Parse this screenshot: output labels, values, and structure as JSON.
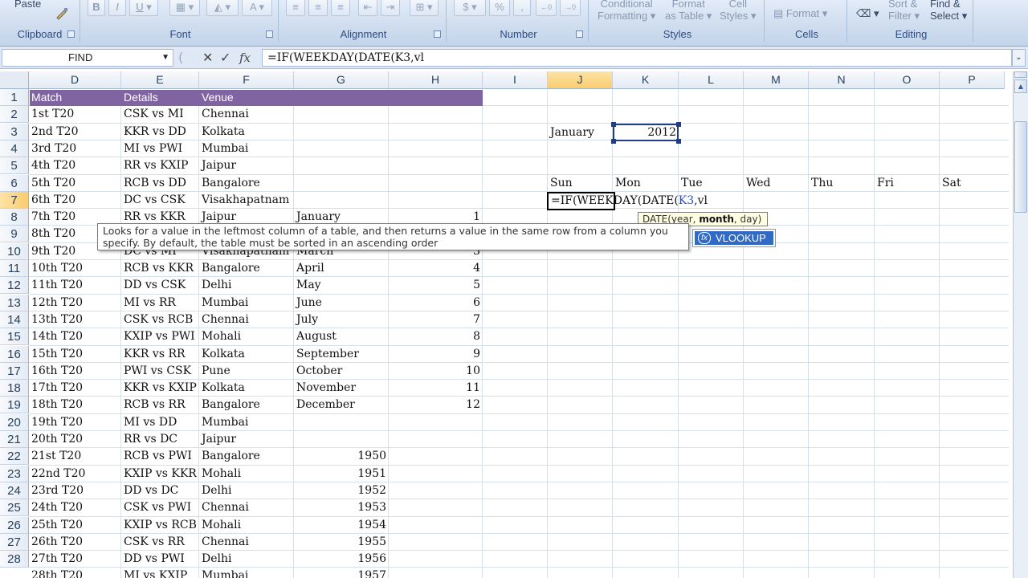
{
  "ribbon": {
    "clipboard": {
      "label": "Clipboard",
      "paste": "Paste"
    },
    "font": {
      "label": "Font",
      "bold": "B",
      "italic": "I",
      "underline": "U"
    },
    "alignment": {
      "label": "Alignment"
    },
    "number": {
      "label": "Number",
      "currency": "$",
      "percent": "%",
      "comma": ","
    },
    "styles": {
      "label": "Styles",
      "conditional_formatting": "Conditional Formatting",
      "format_as_table": "Format as Table",
      "cell_styles": "Cell Styles",
      "conditional_l1": "Conditional",
      "conditional_l2": "Formatting",
      "format_l1": "Format",
      "format_l2": "as Table",
      "cell_l1": "Cell",
      "cell_l2": "Styles"
    },
    "cells": {
      "label": "Cells",
      "format": "Format"
    },
    "editing": {
      "label": "Editing",
      "sort_l1": "Sort &",
      "sort_l2": "Filter",
      "find_l1": "Find &",
      "find_l2": "Select"
    }
  },
  "formula_bar": {
    "name_box": "FIND",
    "formula": "=IF(WEEKDAY(DATE(K3,vl"
  },
  "columns": [
    "D",
    "E",
    "F",
    "G",
    "H",
    "I",
    "J",
    "K",
    "L",
    "M",
    "N",
    "O",
    "P"
  ],
  "selected_column": "J",
  "rows": [
    "1",
    "2",
    "3",
    "4",
    "5",
    "6",
    "7",
    "8",
    "9",
    "10",
    "11",
    "12",
    "13",
    "14",
    "15",
    "16",
    "17",
    "18",
    "19",
    "20",
    "21",
    "22",
    "23",
    "24",
    "25",
    "26",
    "27",
    "28"
  ],
  "selected_row": "7",
  "table_header": {
    "match": "Match",
    "details": "Details",
    "venue": "Venue"
  },
  "matches": [
    {
      "match": "1st T20",
      "details": "CSK vs MI",
      "venue": "Chennai"
    },
    {
      "match": "2nd T20",
      "details": "KKR vs DD",
      "venue": "Kolkata"
    },
    {
      "match": "3rd T20",
      "details": "MI vs PWI",
      "venue": "Mumbai"
    },
    {
      "match": "4th T20",
      "details": "RR vs KXIP",
      "venue": "Jaipur"
    },
    {
      "match": "5th T20",
      "details": "RCB vs DD",
      "venue": "Bangalore"
    },
    {
      "match": "6th T20",
      "details": "DC vs CSK",
      "venue": "Visakhapatnam"
    },
    {
      "match": "7th T20",
      "details": "RR vs KKR",
      "venue": "Jaipur"
    },
    {
      "match": "8th T20",
      "details": "",
      "venue": ""
    },
    {
      "match": "9th T20",
      "details": "DC vs MI",
      "venue": "Visakhapatnam"
    },
    {
      "match": "10th T20",
      "details": "RCB vs KKR",
      "venue": "Bangalore"
    },
    {
      "match": "11th T20",
      "details": "DD vs CSK",
      "venue": "Delhi"
    },
    {
      "match": "12th T20",
      "details": "MI vs RR",
      "venue": "Mumbai"
    },
    {
      "match": "13th T20",
      "details": "CSK vs RCB",
      "venue": "Chennai"
    },
    {
      "match": "14th T20",
      "details": "KXIP vs PWI",
      "venue": "Mohali"
    },
    {
      "match": "15th T20",
      "details": "KKR vs RR",
      "venue": "Kolkata"
    },
    {
      "match": "16th T20",
      "details": "PWI vs CSK",
      "venue": "Pune"
    },
    {
      "match": "17th T20",
      "details": "KKR vs KXIP",
      "venue": "Kolkata"
    },
    {
      "match": "18th T20",
      "details": "RCB vs RR",
      "venue": "Bangalore"
    },
    {
      "match": "19th T20",
      "details": "MI vs DD",
      "venue": "Mumbai"
    },
    {
      "match": "20th T20",
      "details": "RR vs DC",
      "venue": "Jaipur"
    },
    {
      "match": "21st T20",
      "details": "RCB vs PWI",
      "venue": "Bangalore"
    },
    {
      "match": "22nd T20",
      "details": "KXIP vs KKR",
      "venue": "Mohali"
    },
    {
      "match": "23rd T20",
      "details": "DD vs DC",
      "venue": "Delhi"
    },
    {
      "match": "24th T20",
      "details": "CSK vs PWI",
      "venue": "Chennai"
    },
    {
      "match": "25th T20",
      "details": "KXIP vs RCB",
      "venue": "Mohali"
    },
    {
      "match": "26th T20",
      "details": "CSK vs RR",
      "venue": "Chennai"
    },
    {
      "match": "27th T20",
      "details": "DD vs PWI",
      "venue": "Delhi"
    },
    {
      "match": "28th T20",
      "details": "MI vs KXIP",
      "venue": "Mumbai"
    }
  ],
  "month_list": [
    {
      "name": "January",
      "num": "1"
    },
    {
      "name": "",
      "num": ""
    },
    {
      "name": "March",
      "num": "3"
    },
    {
      "name": "April",
      "num": "4"
    },
    {
      "name": "May",
      "num": "5"
    },
    {
      "name": "June",
      "num": "6"
    },
    {
      "name": "July",
      "num": "7"
    },
    {
      "name": "August",
      "num": "8"
    },
    {
      "name": "September",
      "num": "9"
    },
    {
      "name": "October",
      "num": "10"
    },
    {
      "name": "November",
      "num": "11"
    },
    {
      "name": "December",
      "num": "12"
    }
  ],
  "year_list": [
    "1950",
    "1951",
    "1952",
    "1953",
    "1954",
    "1955",
    "1956",
    "1957"
  ],
  "calendar": {
    "month": "January",
    "year": "2012",
    "days": [
      "Sun",
      "Mon",
      "Tue",
      "Wed",
      "Thu",
      "Fri",
      "Sat"
    ]
  },
  "editing": {
    "prefix": "=IF(WEEKDAY(DATE(",
    "ref": "K3",
    "suffix": ",vl"
  },
  "tooltip": "Looks for a value in the leftmost column of a table, and then returns a value in the same row from a column you specify. By default, the table must be sorted in an ascending order",
  "arg_tip": {
    "fn": "DATE(",
    "arg1": "year, ",
    "arg2_bold": "month",
    "arg3": ", day)"
  },
  "autocomplete": {
    "item": "VLOOKUP",
    "icon": "fx"
  },
  "colors": {
    "header_band": "#8064a2",
    "selection": "#1f3c88",
    "autocomplete_highlight": "#316ac5"
  }
}
